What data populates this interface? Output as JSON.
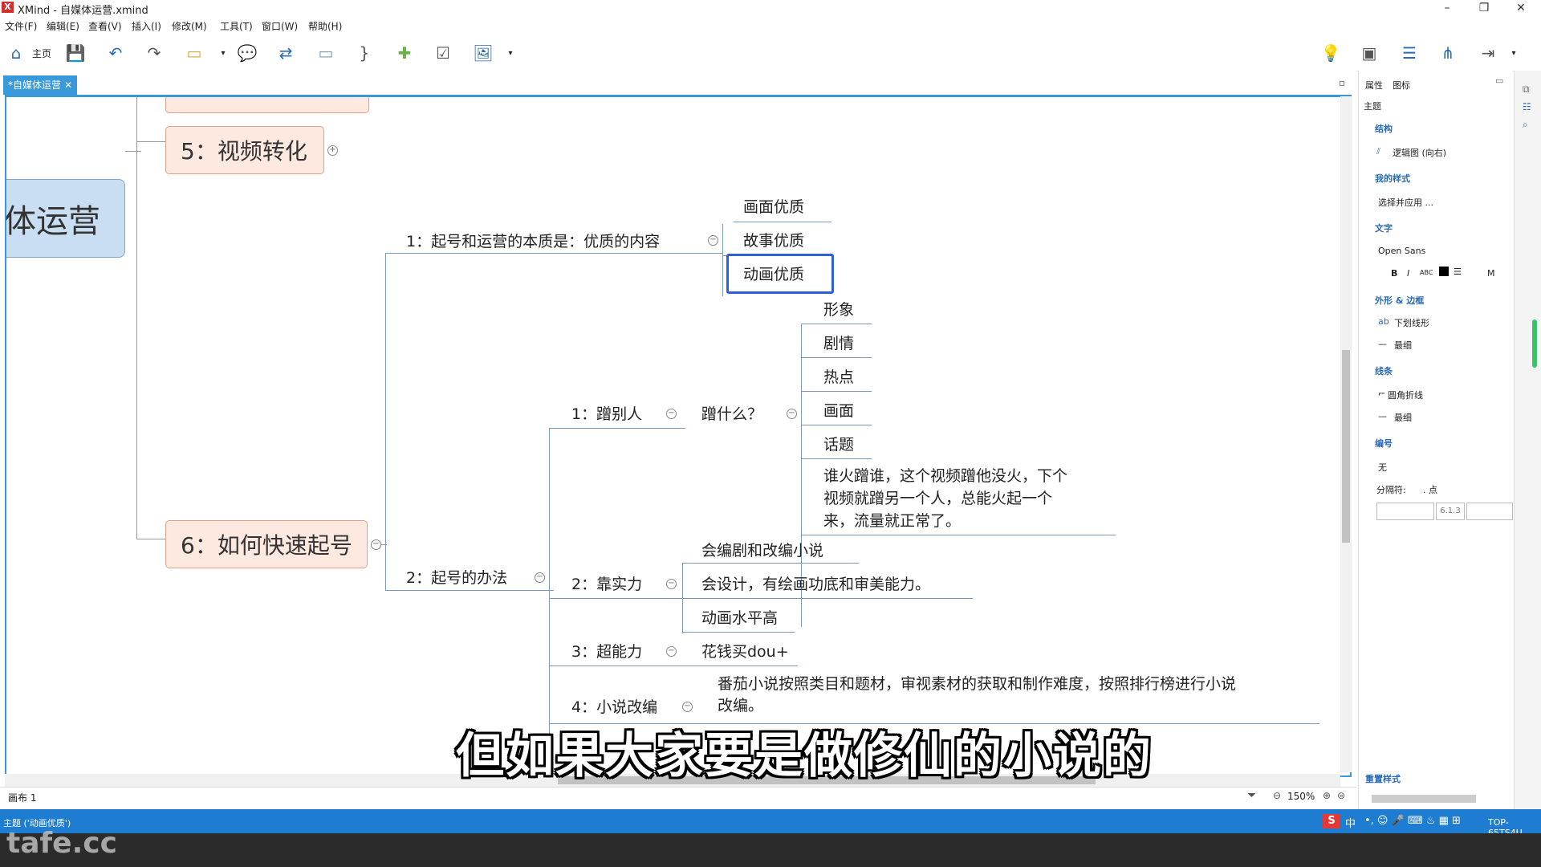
{
  "window": {
    "title": "XMind - 自媒体运营.xmind",
    "app_logo": "X"
  },
  "menu": [
    "文件(F)",
    "编辑(E)",
    "查看(V)",
    "插入(I)",
    "修改(M)",
    "工具(T)",
    "窗口(W)",
    "帮助(H)"
  ],
  "toolbar": {
    "home_label": "主页"
  },
  "tab": {
    "label": "*自媒体运营"
  },
  "canvas": {
    "central": "体运营",
    "topics": [
      "5：视频转化",
      "6：如何快速起号"
    ],
    "branch1": {
      "label": "1：起号和运营的本质是：优质的内容",
      "children": [
        "画面优质",
        "故事优质",
        "动画优质"
      ]
    },
    "branch2": {
      "label": "2：起号的办法"
    },
    "m1": {
      "label": "1：蹭别人",
      "sub": "蹭什么？",
      "children": [
        "形象",
        "剧情",
        "热点",
        "画面",
        "话题"
      ],
      "note": [
        "谁火蹭谁，这个视频蹭他没火，下个",
        "视频就蹭另一个人，总能火起一个",
        "来，流量就正常了。"
      ]
    },
    "m2": {
      "label": "2：靠实力",
      "children": [
        "会编剧和改编小说",
        "会设计，有绘画功底和审美能力。",
        "动画水平高"
      ]
    },
    "m3": {
      "label": "3：超能力",
      "child": "花钱买dou+"
    },
    "m4": {
      "label": "4：小说改编",
      "child": [
        "番茄小说按照类目和题材，审视素材的获取和制作难度，按照排行榜进行小说",
        "改编。"
      ]
    }
  },
  "subtitle": "但如果大家要是做修仙的小说的",
  "bottombar": {
    "sheet": "画布 1",
    "zoom": "150%"
  },
  "rpanel": {
    "tabs": [
      "属性",
      "图标"
    ],
    "header": "主题",
    "structure_label": "结构",
    "structure_value": "逻辑图 (向右)",
    "mystyle_label": "我的样式",
    "mystyle_value": "选择并应用 ...",
    "text_label": "文字",
    "font": "Open Sans",
    "border_label": "外形 & 边框",
    "border_value": "下划线形",
    "border_width": "最细",
    "line_label": "线条",
    "line_value": "圆角折线",
    "line_width": "最细",
    "number_label": "编号",
    "number_value": "无",
    "separator_label": "分隔符:",
    "separator_value": ". 点",
    "number_sample": "6.1.3",
    "reset": "重置样式"
  },
  "statusbar": {
    "text": "主题 ('动画优质')",
    "machine": "TOP-65TS4U"
  },
  "watermark": "tafe.cc"
}
